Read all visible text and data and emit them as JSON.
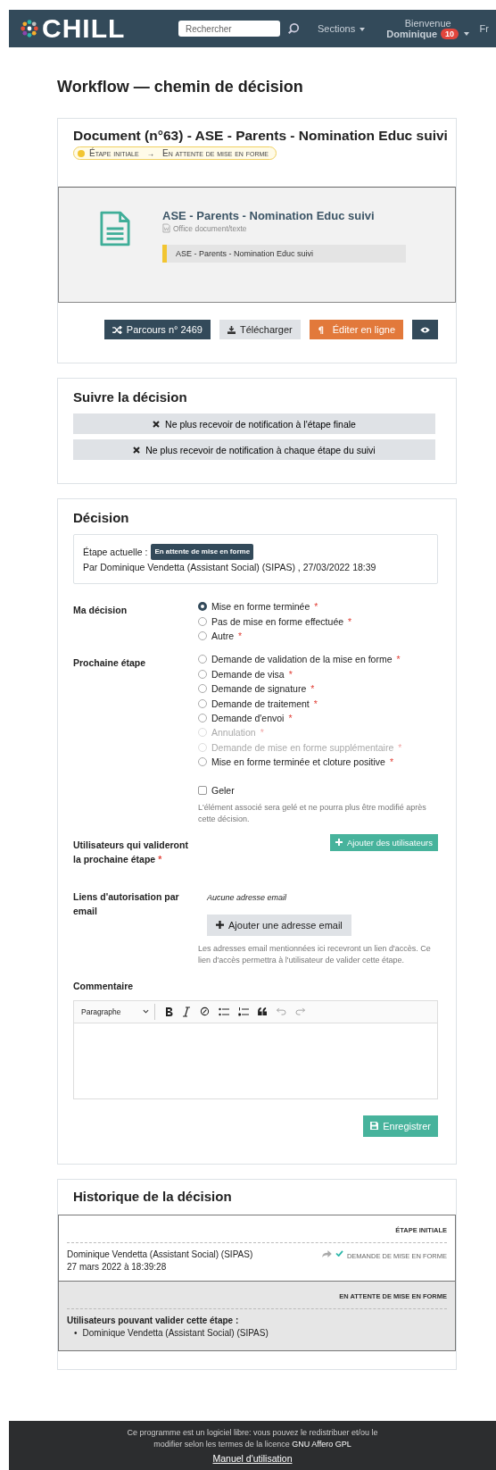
{
  "header": {
    "logo": "CHILL",
    "search": {
      "placeholder": "Rechercher"
    },
    "sections": "Sections",
    "welcome": "Bienvenue",
    "user": "Dominique",
    "notifications": "10",
    "language": "Fr"
  },
  "page_title": "Workflow — chemin de décision",
  "document": {
    "title": "Document (n°63) - ASE - Parents - Nomination Educ suivi",
    "steps": [
      "Étape initiale",
      "En attente de mise en forme"
    ],
    "arrow": "→",
    "name": "ASE - Parents - Nomination Educ suivi",
    "type": "Office document/texte",
    "note": "ASE - Parents - Nomination Educ suivi",
    "buttons": [
      {
        "kind": "parcours",
        "label": "Parcours n° 2469"
      },
      {
        "kind": "download",
        "label": "Télécharger"
      },
      {
        "kind": "edit",
        "label": "Éditer en ligne"
      },
      {
        "kind": "view"
      }
    ]
  },
  "follow": {
    "title": "Suivre la décision",
    "buttons": [
      "Ne plus recevoir de notification à l'étape finale",
      "Ne plus recevoir de notification à chaque étape du suivi"
    ]
  },
  "decision": {
    "title": "Décision",
    "current_label": "Étape actuelle :",
    "current_step": "En attente de mise en forme",
    "by": "Par Dominique Vendetta (Assistant Social) (SIPAS) , 27/03/2022 18:39",
    "my_decision": {
      "label": "Ma décision",
      "options": [
        {
          "label": "Mise en forme terminée",
          "mark": "*",
          "selected": true,
          "disabled": false
        },
        {
          "label": "Pas de mise en forme effectuée",
          "mark": "*",
          "selected": false,
          "disabled": false
        },
        {
          "label": "Autre",
          "mark": "*",
          "selected": false,
          "disabled": false
        }
      ]
    },
    "next_step": {
      "label": "Prochaine étape",
      "options": [
        {
          "label": "Demande de validation de la mise en forme",
          "mark": "*",
          "selected": false,
          "disabled": false
        },
        {
          "label": "Demande de visa",
          "mark": "*",
          "selected": false,
          "disabled": false
        },
        {
          "label": "Demande de signature",
          "mark": "*",
          "selected": false,
          "disabled": false
        },
        {
          "label": "Demande de traitement",
          "mark": "*",
          "selected": false,
          "disabled": false
        },
        {
          "label": "Demande d'envoi",
          "mark": "*",
          "selected": false,
          "disabled": false
        },
        {
          "label": "Annulation",
          "mark": "*",
          "selected": false,
          "disabled": true
        },
        {
          "label": "Demande de mise en forme supplémentaire",
          "mark": "*",
          "selected": false,
          "disabled": true
        },
        {
          "label": "Mise en forme terminée et cloture positive",
          "mark": "*",
          "selected": false,
          "disabled": false
        }
      ]
    },
    "freeze": {
      "label": "Geler",
      "checked": false,
      "help": "L'élément associé sera gelé et ne pourra plus être modifié après cette décision."
    },
    "users": {
      "label": "Utilisateurs qui valideront la prochaine étape",
      "mark": "*",
      "button": "Ajouter des utilisateurs"
    },
    "email": {
      "label": "Liens d'autorisation par email",
      "empty": "Aucune adresse email",
      "button": "Ajouter une adresse email",
      "help": "Les adresses email mentionnées ici recevront un lien d'accès. Ce lien d'accès permettra à l'utilisateur de valider cette étape."
    },
    "comment": {
      "label": "Commentaire",
      "format": "Paragraphe"
    },
    "save": "Enregistrer"
  },
  "history": {
    "title": "Historique de la décision",
    "steps": [
      {
        "kind": "done",
        "step": "ÉTAPE INITIALE",
        "user": "Dominique Vendetta (Assistant Social) (SIPAS)",
        "date": "27 mars 2022 à 18:39:28",
        "transition": "DEMANDE DE MISE EN FORME"
      },
      {
        "kind": "current",
        "step": "EN ATTENTE DE MISE EN FORME",
        "validators_label": "Utilisateurs pouvant valider cette étape :",
        "bullet": "•",
        "validators": [
          "Dominique Vendetta (Assistant Social) (SIPAS)"
        ]
      }
    ]
  },
  "footer": {
    "text": "Ce programme est un logiciel libre: vous pouvez le redistribuer et/ou le modifier selon les termes de la licence **GNU Affero GPL**",
    "link": "Manuel d'utilisation"
  }
}
